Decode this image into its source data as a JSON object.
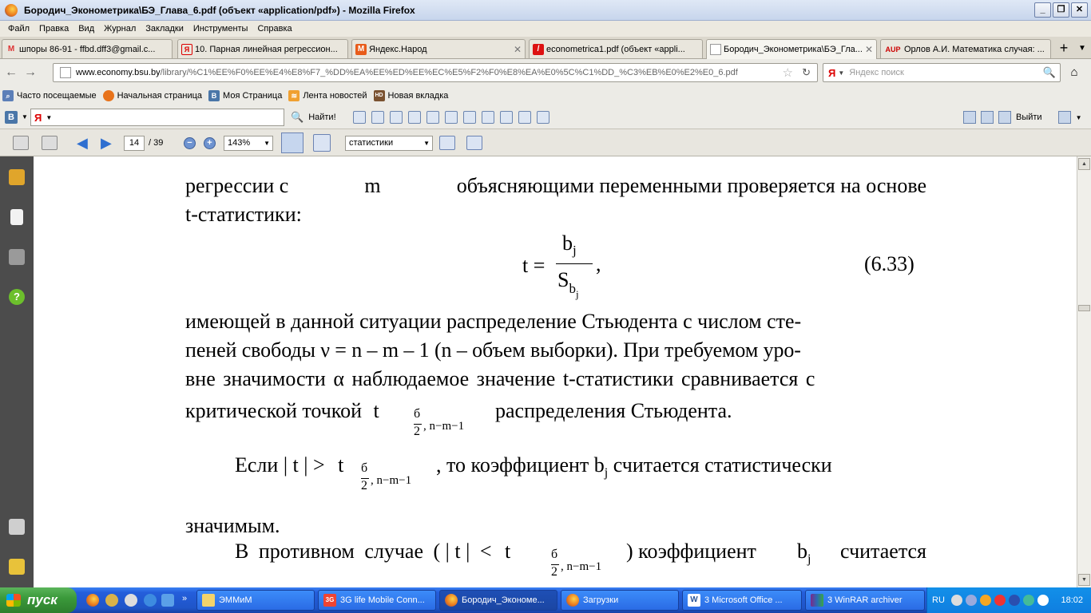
{
  "window": {
    "title": "Бородич_Эконометрика\\БЭ_Глава_6.pdf (объект «application/pdf») - Mozilla Firefox"
  },
  "menu": [
    "Файл",
    "Правка",
    "Вид",
    "Журнал",
    "Закладки",
    "Инструменты",
    "Справка"
  ],
  "tabs": [
    {
      "label": "шпоры 86-91 - ffbd.dff3@gmail.c...",
      "icon": "gmail-icon",
      "active": false
    },
    {
      "label": "10. Парная линейная регрессион...",
      "icon": "yandex-icon",
      "active": false
    },
    {
      "label": "Яндекс.Народ",
      "icon": "narod-icon",
      "active": false
    },
    {
      "label": "econometrica1.pdf (объект «appli...",
      "icon": "pdf-icon",
      "active": false
    },
    {
      "label": "Бородич_Эконометрика\\БЭ_Гла...",
      "icon": "blank-page-icon",
      "active": true
    },
    {
      "label": "Орлов А.И. Математика случая: ...",
      "icon": "aup-icon",
      "active": false
    }
  ],
  "navbar": {
    "url_domain": "www.economy.bsu.by",
    "url_path": "/library/%C1%EE%F0%EE%E4%E8%F7_%DD%EA%EE%ED%EE%EC%E5%F2%F0%E8%EA%E0%5C%C1%DD_%C3%EB%E0%E2%E0_6.pdf",
    "search_placeholder": "Яндекс поиск",
    "search_engine": "Я"
  },
  "bookmarks": [
    "Часто посещаемые",
    "Начальная страница",
    "Моя Страница",
    "Лента новостей",
    "Новая вкладка"
  ],
  "yandex_bar": {
    "logo": "Я",
    "find_label": "Найти!",
    "logout_label": "Выйти",
    "vk_label": "В"
  },
  "pdf_toolbar": {
    "page_current": "14",
    "page_total": "/ 39",
    "zoom": "143%",
    "find_value": "статистики"
  },
  "document": {
    "line1_a": "регрессии с",
    "line1_m": "m",
    "line1_b": "объясняющими переменными проверяется на основе",
    "line2": "t-статистики:",
    "formula_t": "t =",
    "formula_num": "b",
    "formula_num_sub": "j",
    "formula_den": "S",
    "formula_den_sub": "b",
    "formula_den_subsub": "j",
    "formula_comma": ",",
    "formula_number": "(6.33)",
    "p1_l1": "имеющей в данной ситуации распределение Стьюдента с числом сте-",
    "p1_l2": "пеней свободы ν = n – m – 1 (n – объем выборки). При требуемом уро-",
    "p1_l3": "вне значимости α наблюдаемое значение t-статистики сравнивается с",
    "p1_l4_a": "критической точкой",
    "p1_l4_t": "t",
    "p1_l4_b": "распределения Стьюдента.",
    "crit_sub_top": "б",
    "crit_sub_bottom": "2",
    "crit_sub_rest": ", n−m−1",
    "p2_a": "Если",
    "p2_abs": "| t |",
    "p2_gt": ">",
    "p2_t": "t",
    "p2_b": ", то коэффициент b",
    "p2_bsub": "j",
    "p2_c": "считается статистически",
    "p3": "значимым.",
    "p4_a": "В противном случае (",
    "p4_abs": "| t |",
    "p4_lt": "<",
    "p4_t": "t",
    "p4_b": ") коэффициент",
    "p4_bj": "b",
    "p4_bjsub": "j",
    "p4_c": "считается"
  },
  "taskbar": {
    "start_label": "пуск",
    "items": [
      {
        "label": "ЭММиМ",
        "icon": "folder-icon"
      },
      {
        "label": "3G life Mobile Conn...",
        "icon": "3g-icon"
      },
      {
        "label": "Бородич_Экономе...",
        "icon": "firefox-icon"
      },
      {
        "label": "Загрузки",
        "icon": "firefox-icon"
      },
      {
        "label": "3 Microsoft Office ...",
        "icon": "word-icon"
      },
      {
        "label": "3 WinRAR archiver",
        "icon": "winrar-icon"
      }
    ],
    "lang": "RU",
    "clock": "18:02"
  }
}
